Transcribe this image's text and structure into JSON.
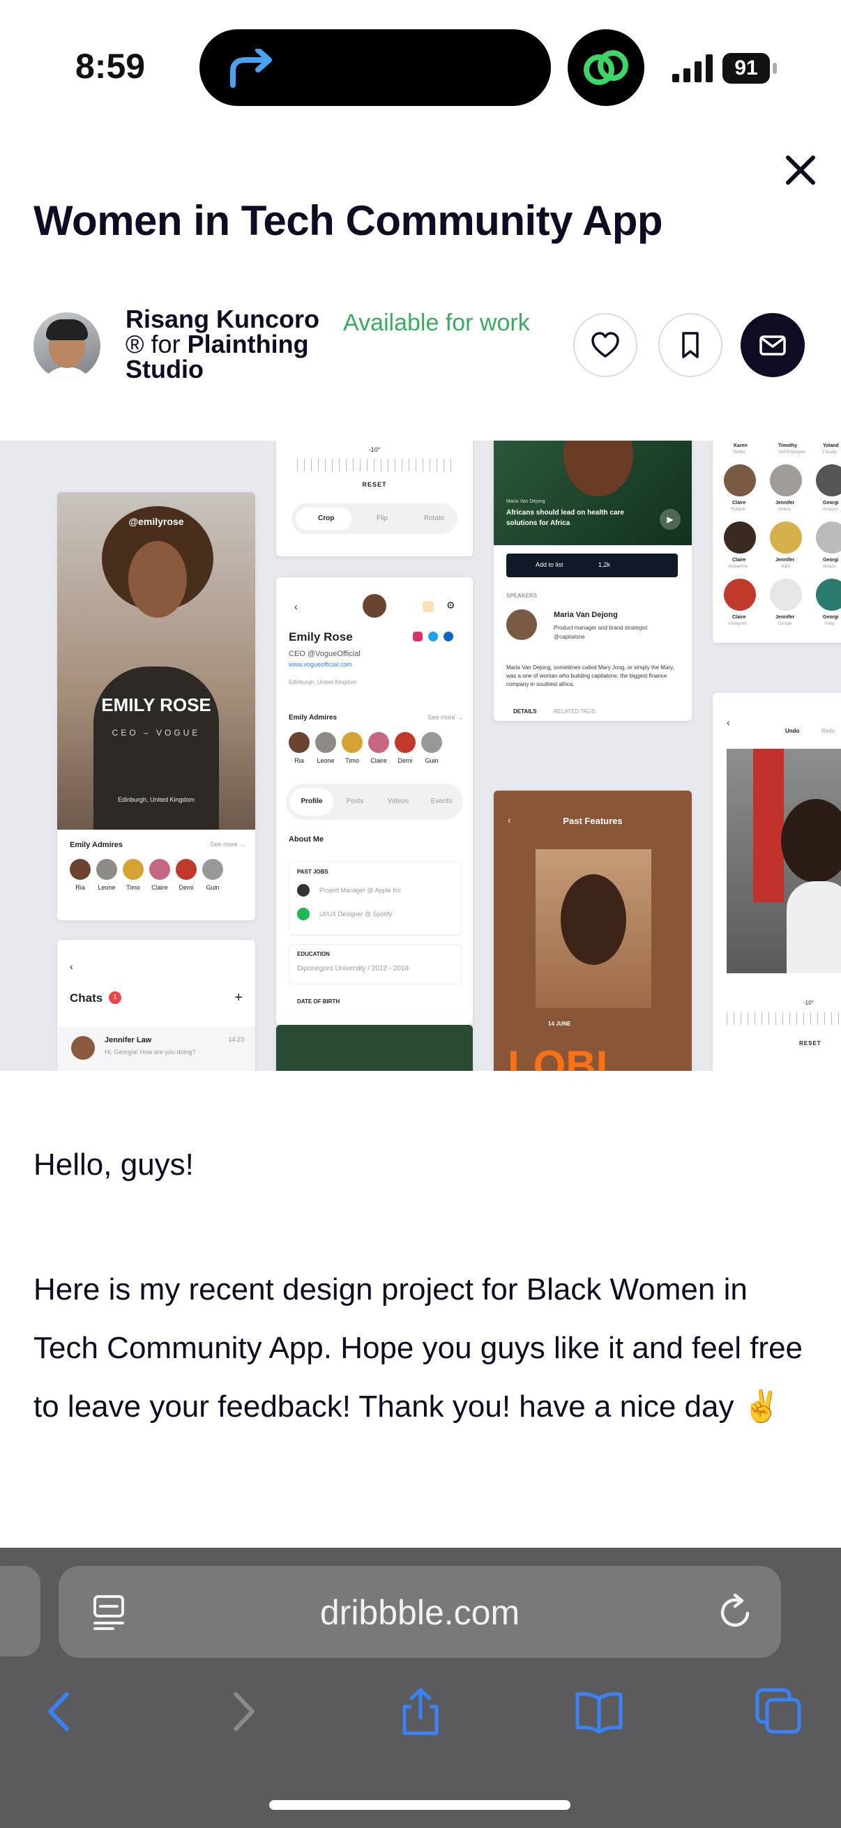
{
  "status_bar": {
    "time": "8:59",
    "battery": "91"
  },
  "post": {
    "title": "Women in Tech Community App",
    "author_name": "Risang Kuncoro",
    "pro_badge": "®",
    "for_word": "for",
    "team_line1": "Plainthing",
    "team_line2": "Studio",
    "availability": "Available for work"
  },
  "shot": {
    "card1": {
      "handle": "@emilyrose",
      "name": "EMILY ROSE",
      "role": "CEO – VOGUE",
      "location": "Edinburgh, United Kingdom",
      "admires_label": "Emily Admires",
      "see_more": "See more →",
      "friends": [
        "Ria",
        "Leone",
        "Timo",
        "Claire",
        "Demi",
        "Guin"
      ]
    },
    "card2": {
      "angle": "-10°",
      "reset": "RESET",
      "crop": "Crop",
      "flip": "Flip",
      "rotate": "Rotate"
    },
    "card3": {
      "name": "Emily Rose",
      "role": "CEO @VogueOfficial",
      "site": "www.vogueofficial.com",
      "location": "Edinburgh, United Kingdom",
      "admires_label": "Emily Admires",
      "see_more": "See more →",
      "friends": [
        "Ria",
        "Leone",
        "Timo",
        "Claire",
        "Demi",
        "Guin"
      ],
      "tabs": [
        "Profile",
        "Posts",
        "Videos",
        "Events"
      ],
      "about": "About Me",
      "past_jobs": "PAST JOBS",
      "job1": "Project Manager @ Apple Inc",
      "job2": "UI/UX Designer @ Spotify",
      "education": "EDUCATION",
      "school": "Diponegoro University / 2012 - 2018",
      "dob": "DATE OF BIRTH"
    },
    "card4": {
      "byline": "Maria Van Dejong",
      "headline": "Africans should lead on health care solutions for Africa",
      "add_to_list": "Add to list",
      "likes": "1,2k",
      "speakers": "SPEAKERS",
      "speaker_name": "Maria Van Dejong",
      "speaker_role": "Product manager and brand strategist @capitalone",
      "bio": "Maria Van Dejong, sometimes called Mary Jong, or simply the Mary, was a one of woman who building capitalone, the biggest finance company in southest africa.",
      "tab_details": "DETAILS",
      "tab_related": "RELATED TAGS"
    },
    "card5": {
      "title": "Past Features",
      "date": "14 JUNE",
      "big_text": "LOBI"
    },
    "card6": {
      "chats": "Chats",
      "badge": "1",
      "contact": "Jennifer Law",
      "time": "14:23",
      "message": "Hi, Georgia! How are you doing?"
    },
    "card7": {
      "people": [
        [
          "Karen",
          "Netflix"
        ],
        [
          "Timothy",
          "Self Employed"
        ],
        [
          "Yoland",
          "Facebo"
        ],
        [
          "Claire",
          "Rubank"
        ],
        [
          "Jennifer",
          "Sotera"
        ],
        [
          "Georgi",
          "Amazon"
        ],
        [
          "Claire",
          "Avalanche"
        ],
        [
          "Jennifer",
          "IKEA"
        ],
        [
          "Georgi",
          "Amazo"
        ],
        [
          "Claire",
          "Instagram"
        ],
        [
          "Jennifer",
          "Google"
        ],
        [
          "Georgi",
          "Yeely"
        ]
      ]
    },
    "card8": {
      "undo": "Undo",
      "redo": "Redo",
      "angle": "-10°",
      "reset": "RESET"
    }
  },
  "description": {
    "greeting": "Hello, guys!",
    "body": "Here is my recent design project for Black Women in Tech Community App. Hope you guys like it and feel free to leave your feedback! Thank you! have a nice day ✌️"
  },
  "browser": {
    "url": "dribbble.com"
  },
  "icons": [
    "redirect-arrow-icon",
    "fitness-rings-icon",
    "signal-icon",
    "battery-icon",
    "close-icon",
    "heart-icon",
    "bookmark-icon",
    "mail-icon",
    "reader-icon",
    "reload-icon",
    "back-icon",
    "forward-icon",
    "share-icon",
    "bookmarks-icon",
    "tabs-icon"
  ],
  "colors": {
    "accent": "#3bac5f",
    "dark": "#0d0c22",
    "safari_blue": "#3b82f6",
    "toolbar": "#5b5b5e"
  }
}
